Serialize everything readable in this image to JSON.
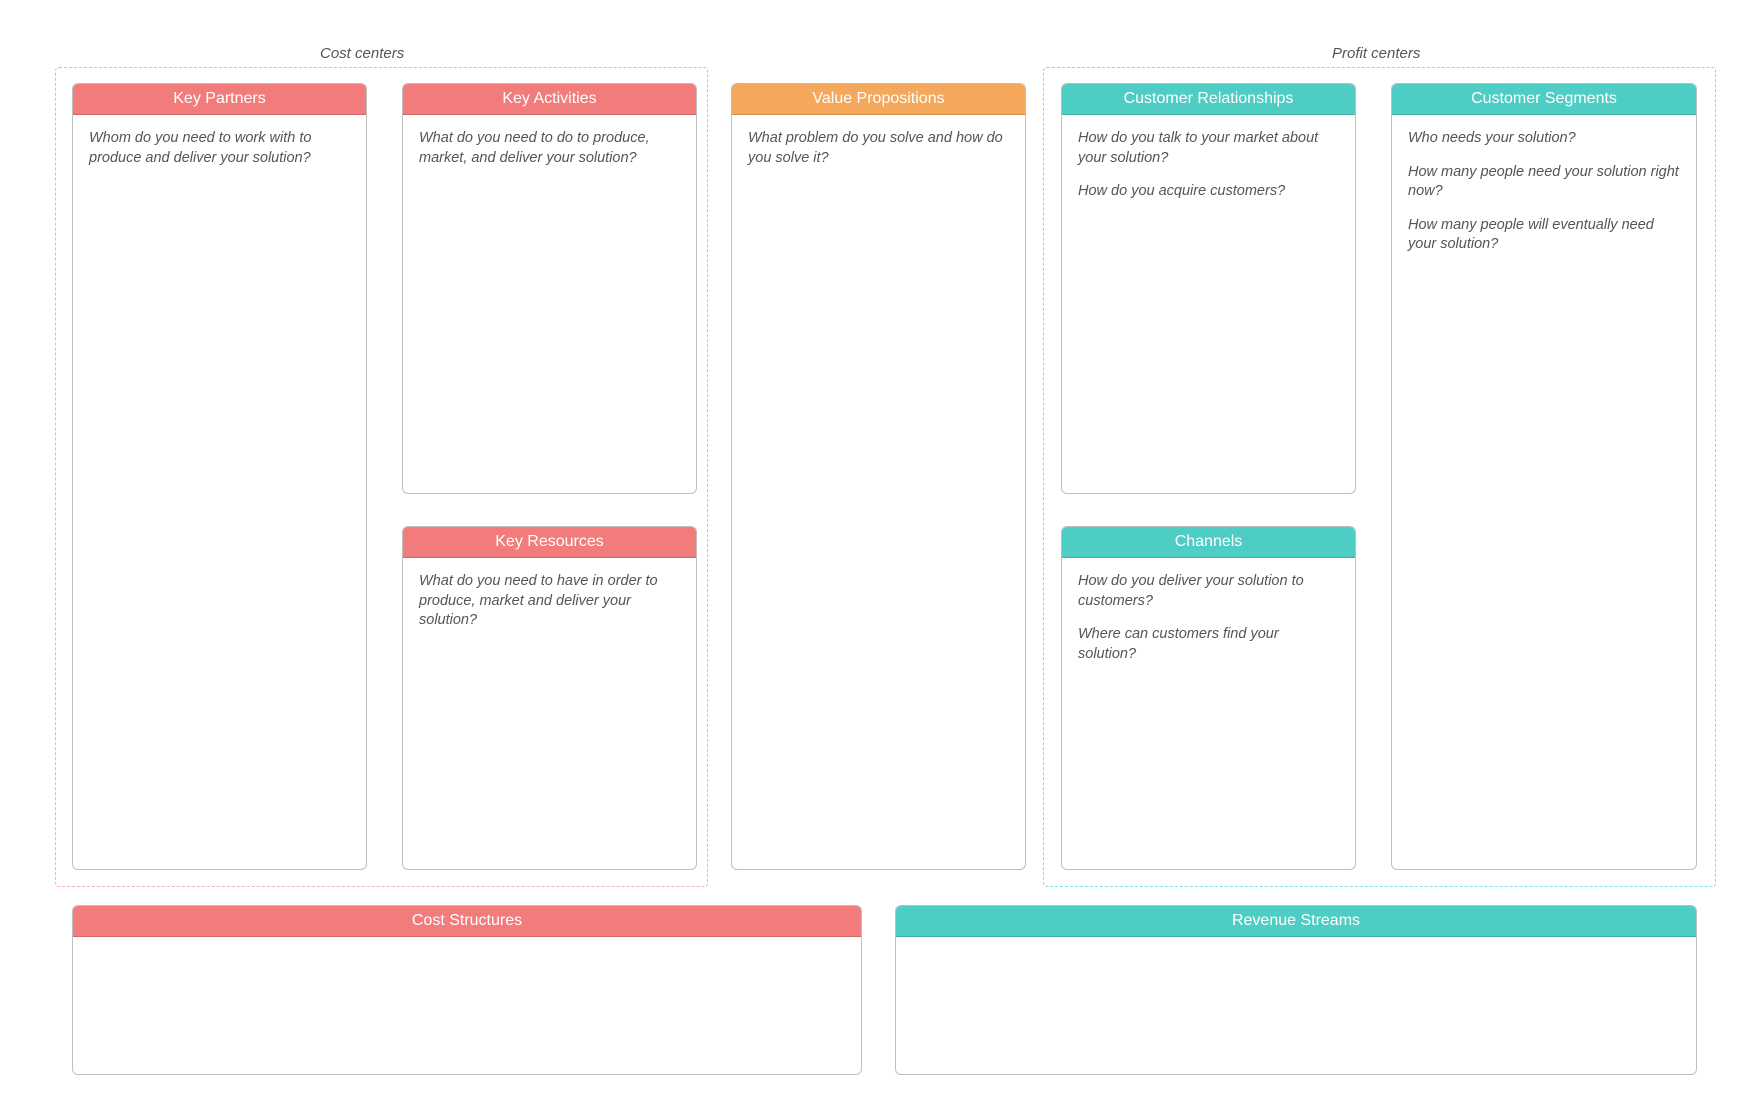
{
  "groups": {
    "cost": {
      "label": "Cost centers",
      "color": "#f7aeb2"
    },
    "profit": {
      "label": "Profit centers",
      "color": "#7ce0e0"
    }
  },
  "cards": {
    "key_partners": {
      "title": "Key Partners",
      "text": [
        "Whom do you need to work with to produce and deliver your solution?"
      ]
    },
    "key_activities": {
      "title": "Key Activities",
      "text": [
        "What do you need to do to produce, market, and deliver your solution?"
      ]
    },
    "key_resources": {
      "title": "Key Resources",
      "text": [
        "What do you need to have in order to produce, market and deliver your solution?"
      ]
    },
    "value_propositions": {
      "title": "Value Propositions",
      "text": [
        "What problem do you solve and how do you solve it?"
      ]
    },
    "customer_relationships": {
      "title": "Customer Relationships",
      "text": [
        "How do you talk to your market about your solution?",
        "How do you acquire customers?"
      ]
    },
    "channels": {
      "title": "Channels",
      "text": [
        "How do you deliver your solution to customers?",
        "Where can customers find your solution?"
      ]
    },
    "customer_segments": {
      "title": "Customer Segments",
      "text": [
        "Who needs your solution?",
        "How many people need your solution right now?",
        "How many people will eventually need your solution?"
      ]
    },
    "cost_structures": {
      "title": "Cost Structures",
      "text": []
    },
    "revenue_streams": {
      "title": "Revenue Streams",
      "text": []
    }
  }
}
